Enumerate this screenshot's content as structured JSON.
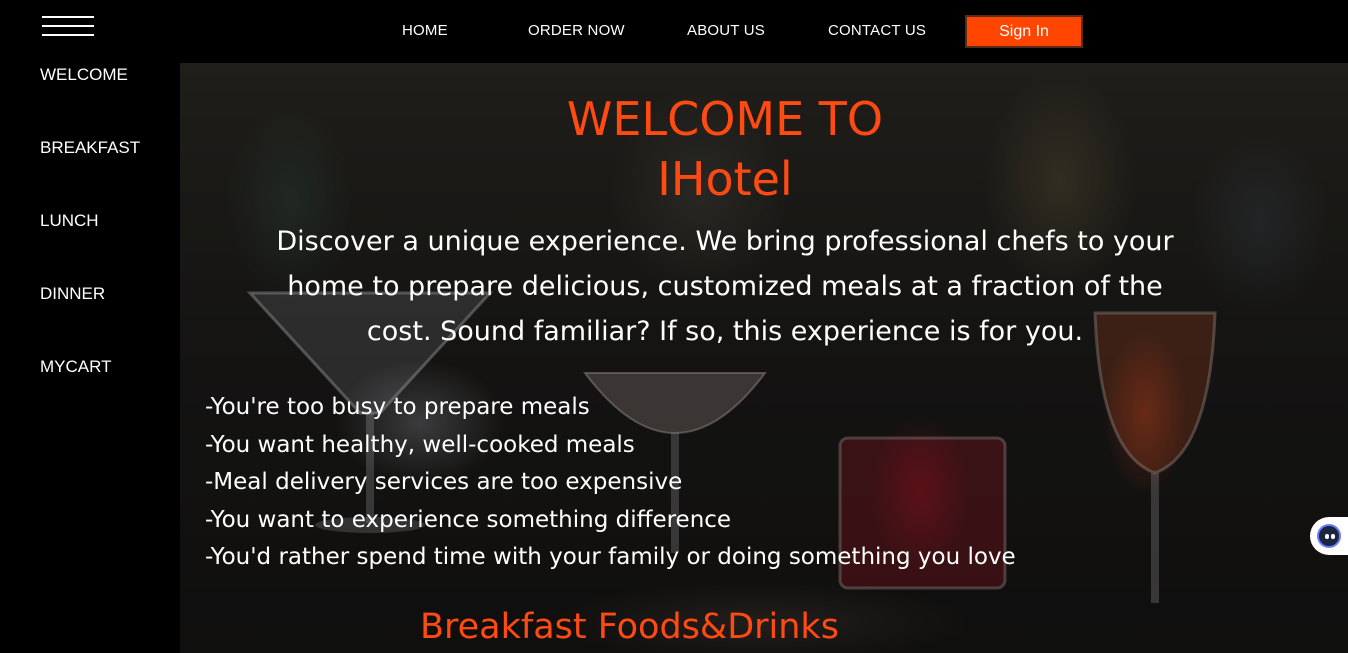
{
  "nav": {
    "menu_icon": "hamburger-menu-icon",
    "links": [
      "HOME",
      "ORDER NOW",
      "ABOUT US",
      "CONTACT US"
    ],
    "signin_label": "Sign In"
  },
  "sidebar": {
    "items": [
      "WELCOME",
      "BREAKFAST",
      "LUNCH",
      "DINNER",
      "MYCART"
    ]
  },
  "hero": {
    "title_line1": "WELCOME TO",
    "title_line2": "IHotel",
    "description": "Discover a unique experience. We bring professional chefs to your home to prepare delicious, customized meals at a fraction of the cost. Sound familiar? If so, this experience is for you.",
    "reasons": [
      "-You're too busy to prepare meals",
      "-You want healthy, well-cooked meals",
      "-Meal delivery services are too expensive",
      "-You want to experience something difference",
      "-You'd rather spend time with your family or doing something you love"
    ],
    "section_title": "Breakfast Foods&Drinks"
  },
  "colors": {
    "accent": "#ff4500",
    "background": "#000000",
    "text": "#ffffff"
  },
  "widgets": {
    "chat_icon": "assistant-chat-icon"
  }
}
